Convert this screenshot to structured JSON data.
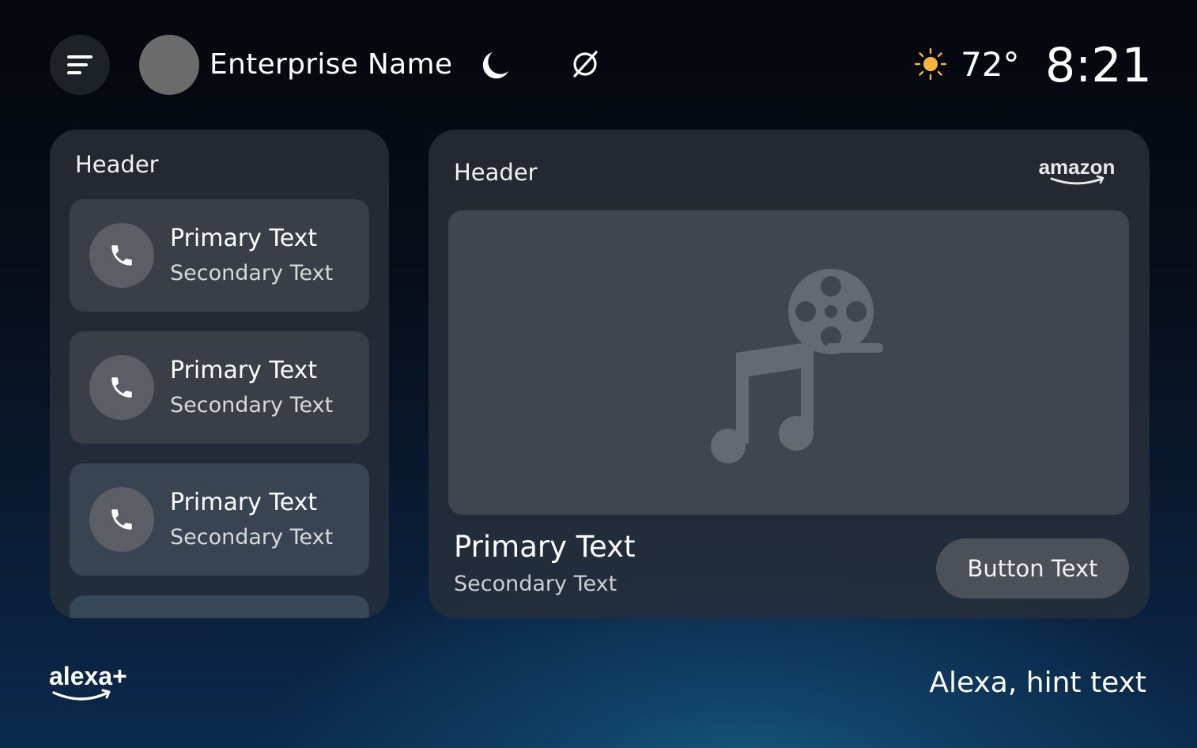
{
  "topbar": {
    "enterprise_name": "Enterprise Name",
    "temperature": "72°",
    "time": "8:21",
    "icons": [
      "menu-icon",
      "moon-icon",
      "no-disturb-icon",
      "sun-icon"
    ],
    "sun_color": "#f5b83d"
  },
  "left_card": {
    "header": "Header",
    "items": [
      {
        "primary": "Primary Text",
        "secondary": "Secondary Text",
        "icon": "phone-icon"
      },
      {
        "primary": "Primary Text",
        "secondary": "Secondary Text",
        "icon": "phone-icon"
      },
      {
        "primary": "Primary Text",
        "secondary": "Secondary Text",
        "icon": "phone-icon"
      }
    ]
  },
  "right_card": {
    "header": "Header",
    "brand": "amazon",
    "media_icon": "film-music-icon",
    "primary": "Primary Text",
    "secondary": "Secondary Text",
    "button_label": "Button Text"
  },
  "footer": {
    "brand": "alexa+",
    "hint": "Alexa, hint text"
  }
}
